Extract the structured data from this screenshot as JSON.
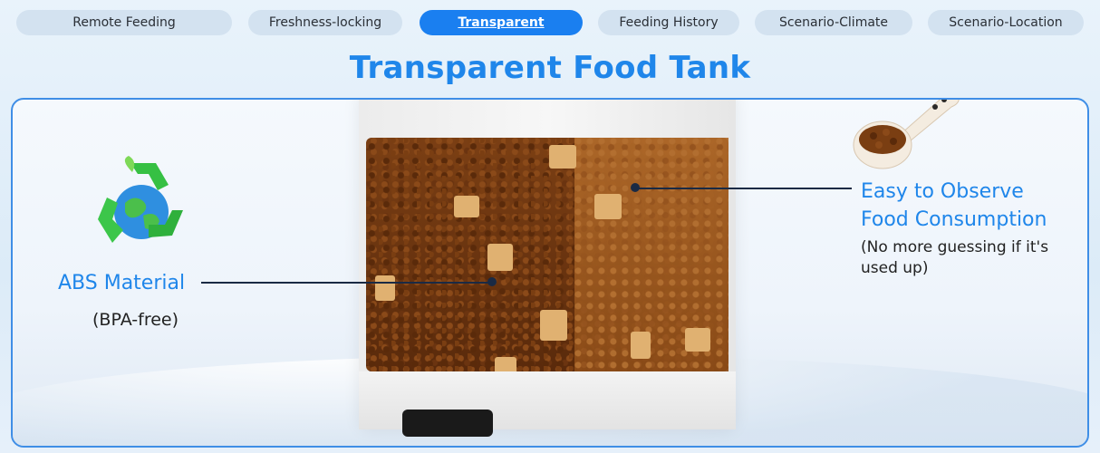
{
  "tabs": [
    {
      "label": "Remote Feeding",
      "active": false
    },
    {
      "label": "Freshness-locking",
      "active": false
    },
    {
      "label": "Transparent",
      "active": true
    },
    {
      "label": "Feeding History",
      "active": false
    },
    {
      "label": "Scenario-Climate",
      "active": false
    },
    {
      "label": "Scenario-Location",
      "active": false
    }
  ],
  "page_title": "Transparent Food Tank",
  "left_feature": {
    "label": "ABS Material",
    "sub": "(BPA-free)",
    "icon": "recycle-globe-icon"
  },
  "right_feature": {
    "label_line1": "Easy to Observe",
    "label_line2": "Food Consumption",
    "sub_line1": "(No more guessing if it's",
    "sub_line2": "used up)",
    "icon": "food-scoop-icon"
  },
  "colors": {
    "accent": "#1f86ea",
    "tab_active": "#1a7ff0",
    "tab_inactive": "#d3e2f0",
    "frame_border": "#3f8ee6"
  }
}
